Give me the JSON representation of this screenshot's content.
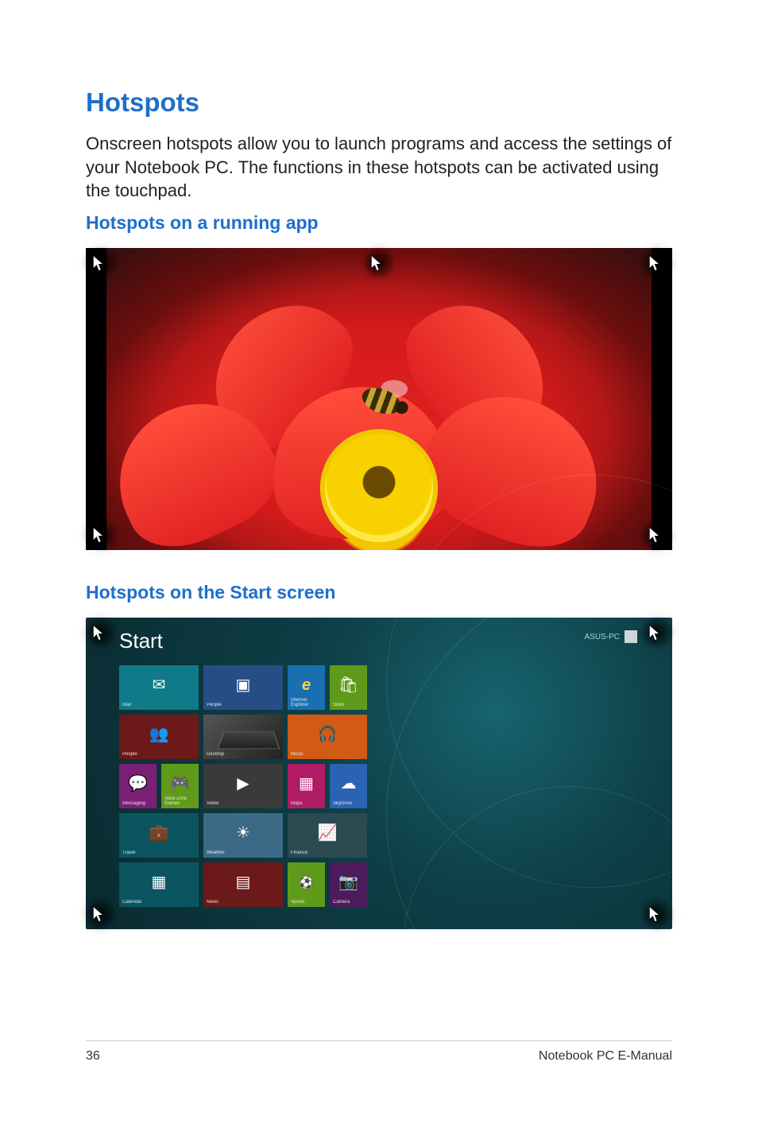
{
  "page": {
    "number": "36",
    "footer": "Notebook PC E-Manual"
  },
  "headings": {
    "title": "Hotspots",
    "sub_running": "Hotspots on a running app",
    "sub_start": "Hotspots on the Start screen"
  },
  "body": {
    "p1": "Onscreen hotspots allow you to launch programs and access the settings of your Notebook PC. The functions in these hotspots can be activated using the touchpad."
  },
  "start_screen": {
    "label": "Start",
    "user": "ASUS-PC",
    "tiles": {
      "mail": "Mail",
      "people_tile": "People",
      "ie": "Internet Explorer",
      "store": "Store",
      "people": "People",
      "desktop": "Desktop",
      "music": "Music",
      "messaging": "Messaging",
      "games": "Xbox LIVE Games",
      "video": "Video",
      "maps": "Maps",
      "skydrive": "SkyDrive",
      "travel": "Travel",
      "weather": "Weather",
      "finance": "Finance",
      "calendar": "Calendar",
      "news": "News",
      "sports": "Sports",
      "camera": "Camera"
    }
  }
}
